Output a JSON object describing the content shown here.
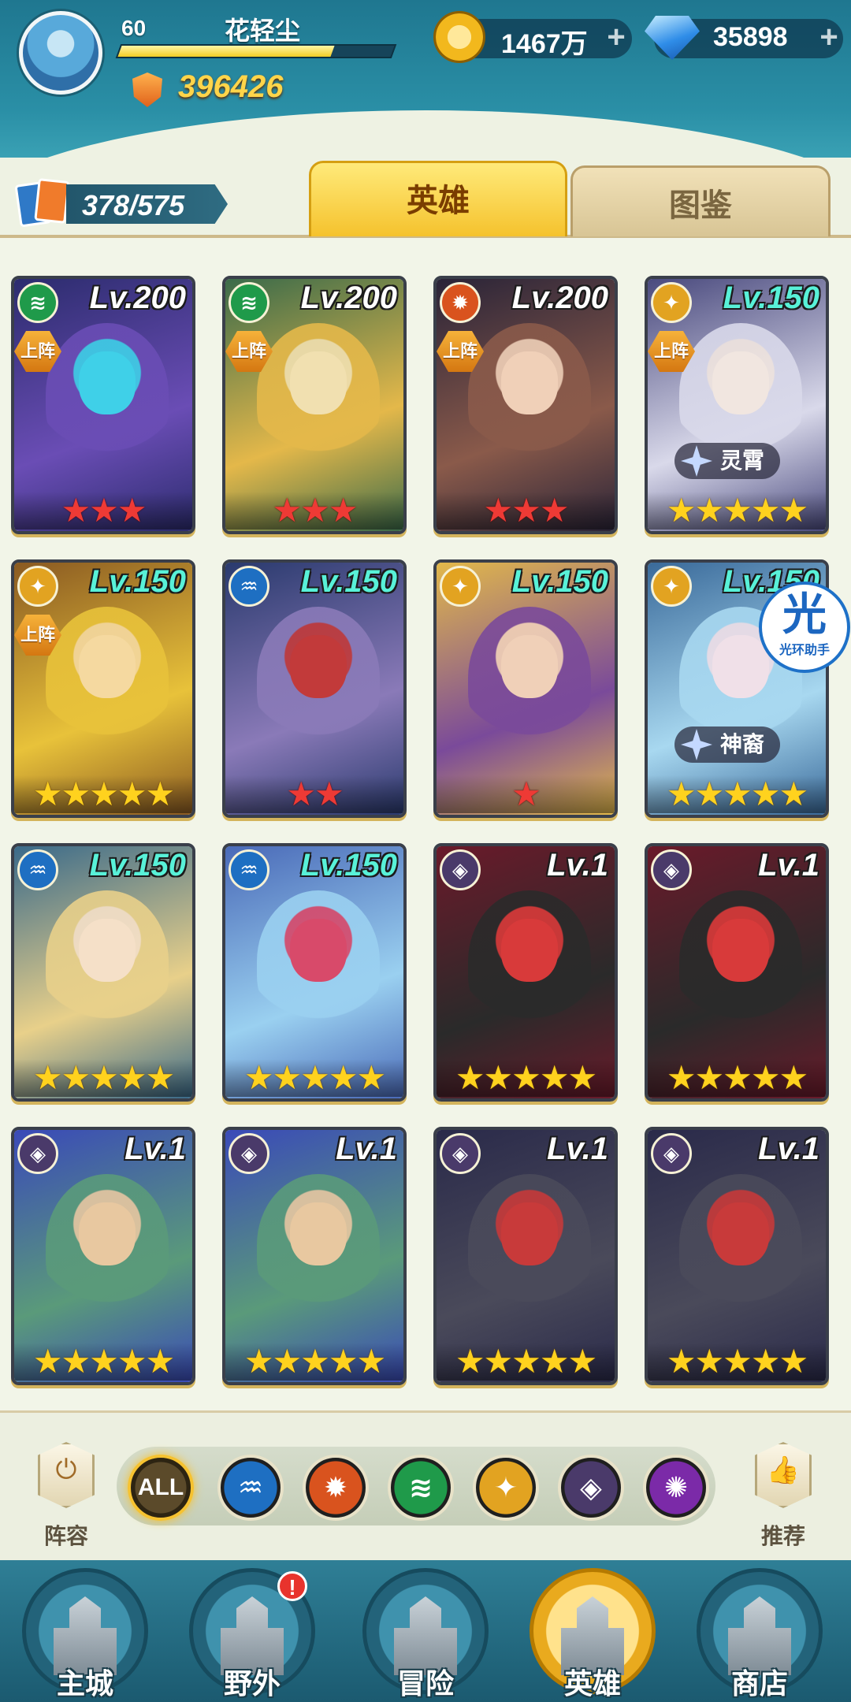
{
  "player": {
    "level": "60",
    "name": "花轻尘",
    "power": "396426",
    "exp_progress": 0.78
  },
  "currency": {
    "gold": "1467万",
    "gems": "35898",
    "add_label": "+"
  },
  "collection": {
    "count": "378/575"
  },
  "tabs": [
    {
      "label": "英雄",
      "active": true
    },
    {
      "label": "图鉴",
      "active": false
    }
  ],
  "deploy_label": "上阵",
  "element_icons": {
    "wind": {
      "glyph": "≋",
      "color": "#1f9a4a"
    },
    "fire": {
      "glyph": "✹",
      "color": "#d9531e"
    },
    "light": {
      "glyph": "✦",
      "color": "#e2a321"
    },
    "water": {
      "glyph": "♒",
      "color": "#1e6fc2"
    },
    "dark": {
      "glyph": "◈",
      "color": "#4a3a6a"
    },
    "void": {
      "glyph": "✺",
      "color": "#7b2aa8"
    }
  },
  "heroes": [
    {
      "level": "Lv.200",
      "element": "wind",
      "deployed": true,
      "stars": 3,
      "star_color": "red",
      "art": [
        "#2c2c6e",
        "#6a4db5",
        "#3fd0e8"
      ]
    },
    {
      "level": "Lv.200",
      "element": "wind",
      "deployed": true,
      "stars": 3,
      "star_color": "red",
      "art": [
        "#3b6b4a",
        "#e4b84a",
        "#f1e0b0"
      ]
    },
    {
      "level": "Lv.200",
      "element": "fire",
      "deployed": true,
      "stars": 3,
      "star_color": "red",
      "art": [
        "#2a2438",
        "#8a5a4a",
        "#f0d0b8"
      ]
    },
    {
      "level": "Lv.150",
      "element": "light",
      "deployed": true,
      "stars": 5,
      "star_color": "gold",
      "title": "灵霄",
      "art": [
        "#4a4a7e",
        "#d9d9ea",
        "#f1e6e0"
      ]
    },
    {
      "level": "Lv.150",
      "element": "light",
      "deployed": true,
      "stars": 5,
      "star_color": "gold",
      "art": [
        "#8a5a22",
        "#e8c23a",
        "#f5d9a0"
      ]
    },
    {
      "level": "Lv.150",
      "element": "water",
      "deployed": false,
      "stars": 2,
      "star_color": "red",
      "art": [
        "#2a3a6e",
        "#8a7ab8",
        "#c23a3a"
      ]
    },
    {
      "level": "Lv.150",
      "element": "light",
      "deployed": false,
      "stars": 1,
      "star_color": "red",
      "art": [
        "#e2b84a",
        "#7a4a9a",
        "#f0d0b8"
      ]
    },
    {
      "level": "Lv.150",
      "element": "light",
      "deployed": false,
      "stars": 5,
      "star_color": "gold",
      "title": "神裔",
      "art": [
        "#3a6a9a",
        "#a8d8f0",
        "#f0e0e8"
      ]
    },
    {
      "level": "Lv.150",
      "element": "water",
      "deployed": false,
      "stars": 5,
      "star_color": "gold",
      "art": [
        "#3a6a8a",
        "#e8d08a",
        "#f5e0c8"
      ]
    },
    {
      "level": "Lv.150",
      "element": "water",
      "deployed": false,
      "stars": 5,
      "star_color": "gold",
      "art": [
        "#4a6ab8",
        "#9ad0f0",
        "#d84a6a"
      ]
    },
    {
      "level": "Lv.1",
      "element": "dark",
      "deployed": false,
      "stars": 5,
      "star_color": "gold",
      "art": [
        "#6a1a2a",
        "#2a2a2a",
        "#d83a3a"
      ]
    },
    {
      "level": "Lv.1",
      "element": "dark",
      "deployed": false,
      "stars": 5,
      "star_color": "gold",
      "art": [
        "#6a1a2a",
        "#2a2a2a",
        "#d83a3a"
      ]
    },
    {
      "level": "Lv.1",
      "element": "dark",
      "deployed": false,
      "stars": 5,
      "star_color": "gold",
      "art": [
        "#3a4ab8",
        "#5a9a7a",
        "#e8c8a0"
      ]
    },
    {
      "level": "Lv.1",
      "element": "dark",
      "deployed": false,
      "stars": 5,
      "star_color": "gold",
      "art": [
        "#3a4ab8",
        "#5a9a7a",
        "#e8c8a0"
      ]
    },
    {
      "level": "Lv.1",
      "element": "dark",
      "deployed": false,
      "stars": 5,
      "star_color": "gold",
      "art": [
        "#2a2a4a",
        "#4a4a5a",
        "#c83a3a"
      ]
    },
    {
      "level": "Lv.1",
      "element": "dark",
      "deployed": false,
      "stars": 5,
      "star_color": "gold",
      "art": [
        "#2a2a4a",
        "#4a4a5a",
        "#c83a3a"
      ]
    }
  ],
  "halo_badge": {
    "glyph": "光",
    "label": "光环助手"
  },
  "filter": {
    "lineup_label": "阵容",
    "recommend_label": "推荐",
    "all_label": "ALL",
    "elements": [
      "water",
      "fire",
      "wind",
      "light",
      "dark",
      "void"
    ]
  },
  "nav": [
    {
      "label": "主城",
      "active": false
    },
    {
      "label": "野外",
      "active": false,
      "alert": "!"
    },
    {
      "label": "冒险",
      "active": false
    },
    {
      "label": "英雄",
      "active": true
    },
    {
      "label": "商店",
      "active": false
    }
  ]
}
